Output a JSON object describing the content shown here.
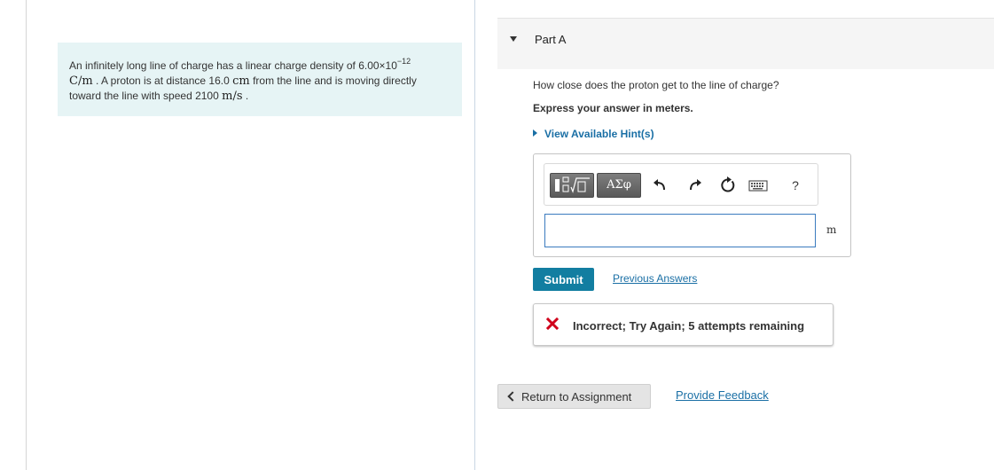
{
  "problem": {
    "text1": "An infinitely long line of charge has a linear charge density of 6.00×10",
    "exp": "−12",
    "unit_density": "C/m",
    "text2": ". A proton is at distance 16.0",
    "unit_cm": "cm",
    "text3": "from the line and is moving directly toward the line with speed 2100",
    "unit_speed": "m/s",
    "text4": "."
  },
  "part": {
    "title": "Part A"
  },
  "question": {
    "text": "How close does the proton get to the line of charge?",
    "express": "Express your answer in meters.",
    "hints": "View Available Hint(s)"
  },
  "toolbar": {
    "greek_label": "ΑΣφ",
    "help_label": "?"
  },
  "answer": {
    "value": "",
    "unit": "m"
  },
  "actions": {
    "submit": "Submit",
    "previous_answers": "Previous Answers"
  },
  "feedback": {
    "text": "Incorrect; Try Again; 5 attempts remaining"
  },
  "footer": {
    "return": "Return to Assignment",
    "provide_feedback": "Provide Feedback"
  },
  "colors": {
    "accent": "#127ea1",
    "link": "#1a6fa5",
    "problem_bg": "#e6f4f5",
    "error": "#d0021b"
  },
  "icons": [
    "template-icon",
    "undo-icon",
    "redo-icon",
    "reset-icon",
    "keyboard-icon",
    "help-icon",
    "x-icon",
    "chevron-left-icon"
  ]
}
